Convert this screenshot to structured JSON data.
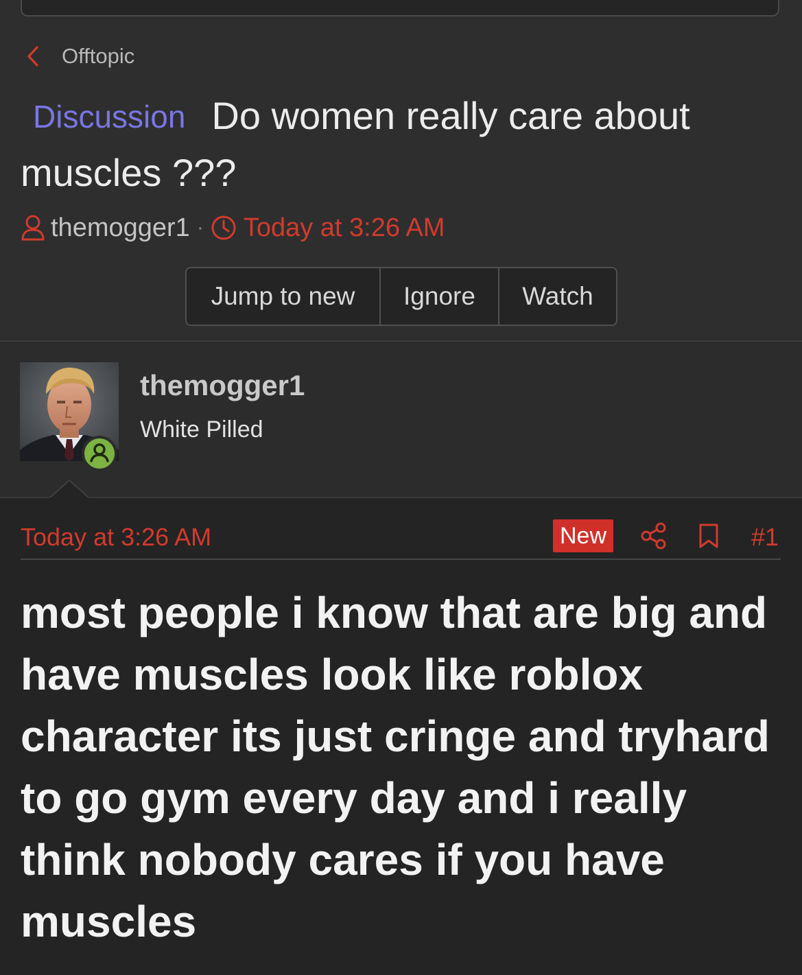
{
  "breadcrumb": {
    "label": "Offtopic"
  },
  "thread": {
    "prefix": "Discussion",
    "title": "Do women really care about muscles ???",
    "author": "themogger1",
    "separator": "·",
    "date": "Today at 3:26 AM"
  },
  "actions": {
    "jump_label": "Jump to new",
    "ignore_label": "Ignore",
    "watch_label": "Watch"
  },
  "post": {
    "username": "themogger1",
    "user_title": "White Pilled",
    "date": "Today at 3:26 AM",
    "badge": "New",
    "number": "#1",
    "body": "most people i know that are big and have muscles look like roblox character its just cringe and tryhard to go gym every day and i really think nobody cares if you have muscles"
  },
  "icons": {
    "back": "chevron-left-icon",
    "author": "user-icon",
    "time": "clock-icon",
    "share": "share-icon",
    "bookmark": "bookmark-icon",
    "status": "online-status-icon"
  },
  "colors": {
    "accent_red": "#d23a2e",
    "prefix_purple": "#7a76e4",
    "online_green": "#7cb342",
    "new_badge": "#d0302a"
  }
}
